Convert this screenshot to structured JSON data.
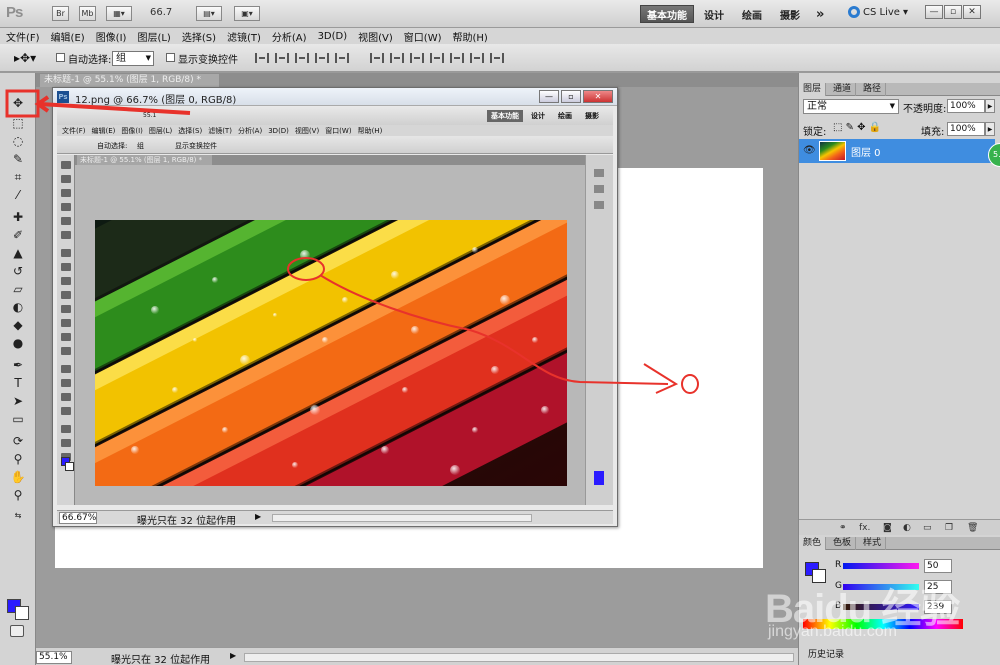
{
  "app": {
    "logo": "Ps",
    "mini_buttons": [
      "Br",
      "Mb"
    ],
    "zoom": "66.7",
    "workspaces": [
      "基本功能",
      "设计",
      "绘画",
      "摄影"
    ],
    "more": "»",
    "cs_live": "CS Live"
  },
  "menu": [
    "文件(F)",
    "编辑(E)",
    "图像(I)",
    "图层(L)",
    "选择(S)",
    "滤镜(T)",
    "分析(A)",
    "3D(D)",
    "视图(V)",
    "窗口(W)",
    "帮助(H)"
  ],
  "options": {
    "auto_select_label": "自动选择:",
    "auto_select_value": "组",
    "transform_label": "显示变换控件"
  },
  "document_tab": "未标题-1 @ 55.1% (图层 1, RGB/8) *",
  "inner_window": {
    "title": "12.png @ 66.7% (图层 0, RGB/8)",
    "zoom_value": "55.1",
    "workspaces": [
      "基本功能",
      "设计",
      "绘画",
      "摄影"
    ],
    "menu": [
      "文件(F)",
      "编辑(E)",
      "图像(I)",
      "图层(L)",
      "选择(S)",
      "滤镜(T)",
      "分析(A)",
      "3D(D)",
      "视图(V)",
      "窗口(W)",
      "帮助(H)"
    ],
    "auto_select_label": "自动选择:",
    "auto_select_value": "组",
    "transform_label": "显示变换控件",
    "doc_tab": "未标题-1 @ 55.1% (图层 1, RGB/8) *",
    "status_zoom": "66.67%",
    "status_msg": "曝光只在 32 位起作用"
  },
  "layers_panel": {
    "tabs": [
      "图层",
      "通道",
      "路径"
    ],
    "blend_mode": "正常",
    "opacity_label": "不透明度:",
    "opacity_value": "100%",
    "lock_label": "锁定:",
    "fill_label": "填充:",
    "fill_value": "100%",
    "layer_name": "图层 0"
  },
  "color_panel": {
    "tabs": [
      "颜色",
      "色板",
      "样式"
    ],
    "r_label": "R",
    "r_value": "50",
    "g_label": "G",
    "g_value": "25",
    "b_label": "B",
    "b_value": "239",
    "foreground": "#2a1bff",
    "background": "#ffffff"
  },
  "history_tab": "历史记录",
  "status": {
    "zoom": "55.1%",
    "message": "曝光只在 32 位起作用"
  },
  "colors": {
    "annotation_red": "#e8322b",
    "layer_selected": "#3f8de0"
  },
  "watermark": {
    "brand": "Baidu 经验",
    "url": "jingyan.baidu.com"
  }
}
